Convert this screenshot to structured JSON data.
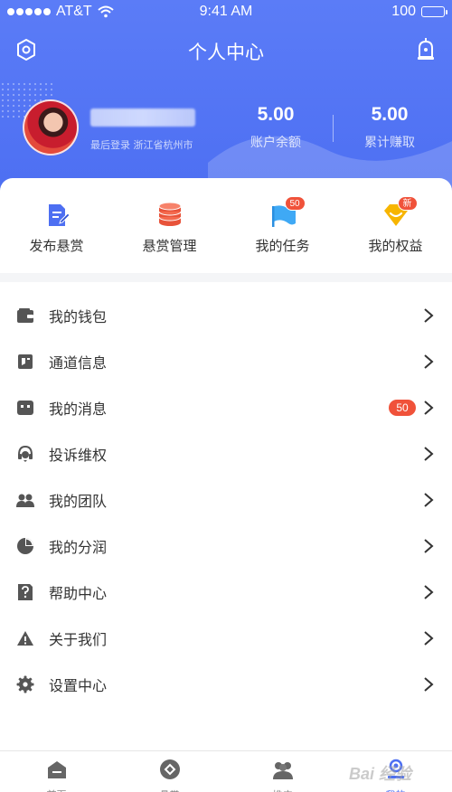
{
  "status_bar": {
    "carrier": "AT&T",
    "time": "9:41 AM",
    "battery": "100"
  },
  "header": {
    "title": "个人中心",
    "last_login": "最后登录 浙江省杭州市",
    "stats": [
      {
        "value": "5.00",
        "label": "账户余额"
      },
      {
        "value": "5.00",
        "label": "累计赚取"
      }
    ]
  },
  "quick_actions": [
    {
      "label": "发布悬赏",
      "icon": "document-edit-icon",
      "badge": ""
    },
    {
      "label": "悬赏管理",
      "icon": "coin-stack-icon",
      "badge": ""
    },
    {
      "label": "我的任务",
      "icon": "flag-icon",
      "badge": "50"
    },
    {
      "label": "我的权益",
      "icon": "diamond-icon",
      "badge": "新"
    }
  ],
  "menu": [
    {
      "label": "我的钱包",
      "icon": "wallet-icon",
      "badge": ""
    },
    {
      "label": "通道信息",
      "icon": "channel-icon",
      "badge": ""
    },
    {
      "label": "我的消息",
      "icon": "message-icon",
      "badge": "50"
    },
    {
      "label": "投诉维权",
      "icon": "headset-icon",
      "badge": ""
    },
    {
      "label": "我的团队",
      "icon": "team-icon",
      "badge": ""
    },
    {
      "label": "我的分润",
      "icon": "pie-chart-icon",
      "badge": ""
    },
    {
      "label": "帮助中心",
      "icon": "help-icon",
      "badge": ""
    },
    {
      "label": "关于我们",
      "icon": "info-icon",
      "badge": ""
    },
    {
      "label": "设置中心",
      "icon": "gear-icon",
      "badge": ""
    }
  ],
  "tab_bar": [
    {
      "label": "首页",
      "icon": "home-icon",
      "active": false
    },
    {
      "label": "悬赏",
      "icon": "bounty-icon",
      "active": false
    },
    {
      "label": "推广",
      "icon": "promote-icon",
      "active": false
    },
    {
      "label": "我的",
      "icon": "profile-icon",
      "active": true
    }
  ],
  "colors": {
    "primary": "#4d6ff2",
    "badge": "#f0523a",
    "text": "#333333",
    "icon_gray": "#555555"
  },
  "watermark": "Bai 经验"
}
